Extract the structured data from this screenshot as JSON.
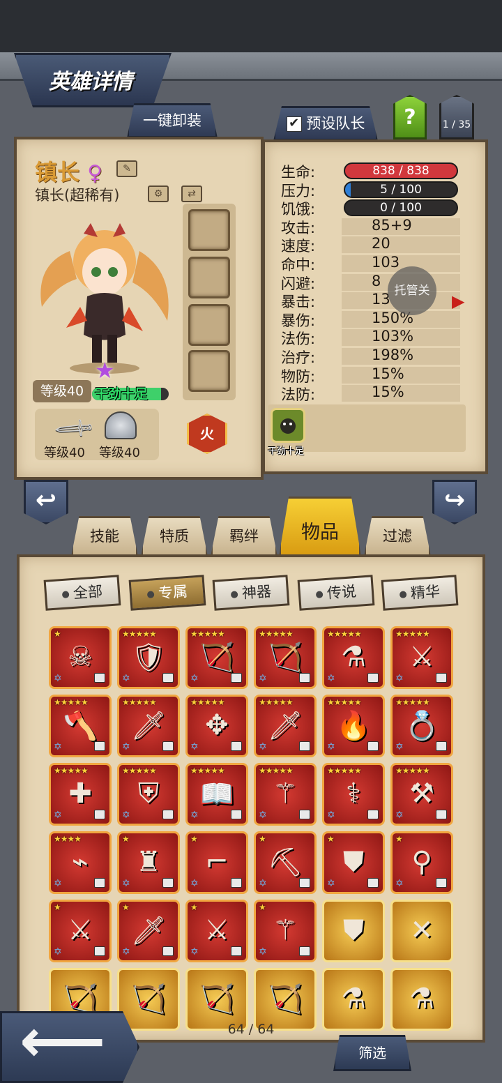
{
  "header": {
    "title": "英雄详情"
  },
  "top_buttons": {
    "unequip_all": "一键卸装",
    "preset_leader": "预设队长",
    "help": "?",
    "page_indicator": "1 / 35"
  },
  "hero": {
    "name": "镇长",
    "gender_symbol": "♀",
    "rarity_line": "镇长(超稀有)",
    "level": "等级40",
    "mood": "干劲十足",
    "mood_fill": 0.9,
    "element": "火",
    "equip": [
      {
        "label": "等级40",
        "icon": "sword-icon"
      },
      {
        "label": "等级40",
        "icon": "helmet-icon"
      }
    ]
  },
  "stats": [
    {
      "label": "生命:",
      "value": "838 / 838",
      "bar": "hp",
      "fill": 1.0,
      "color": "#d1383d"
    },
    {
      "label": "压力:",
      "value": "5 / 100",
      "bar": "stress",
      "fill": 0.05,
      "color": "#2f7fd6"
    },
    {
      "label": "饥饿:",
      "value": "0 / 100",
      "bar": "hunger",
      "fill": 0.0,
      "color": "#777777"
    },
    {
      "label": "攻击:",
      "value": "85+9"
    },
    {
      "label": "速度:",
      "value": "20"
    },
    {
      "label": "命中:",
      "value": "103"
    },
    {
      "label": "闪避:",
      "value": "8"
    },
    {
      "label": "暴击:",
      "value": "13"
    },
    {
      "label": "暴伤:",
      "value": "150%"
    },
    {
      "label": "法伤:",
      "value": "103%"
    },
    {
      "label": "治疗:",
      "value": "198%"
    },
    {
      "label": "物防:",
      "value": "15%"
    },
    {
      "label": "法防:",
      "value": "15%"
    }
  ],
  "skill": {
    "label": "干劲十足"
  },
  "auto_toggle": "托管关",
  "tabs": [
    "技能",
    "特质",
    "羁绊",
    "物品",
    "过滤"
  ],
  "active_tab": "物品",
  "filters": [
    "全部",
    "专属",
    "神器",
    "传说",
    "精华"
  ],
  "active_filter": "专属",
  "items": [
    {
      "stars": "★",
      "glyph": "☠",
      "type": "red"
    },
    {
      "stars": "★★★★★",
      "glyph": "🛡",
      "type": "red"
    },
    {
      "stars": "★★★★★",
      "glyph": "🏹",
      "type": "red"
    },
    {
      "stars": "★★★★★",
      "glyph": "🏹",
      "type": "red"
    },
    {
      "stars": "★★★★★",
      "glyph": "⚗",
      "type": "red"
    },
    {
      "stars": "★★★★★",
      "glyph": "⚔",
      "type": "red"
    },
    {
      "stars": "★★★★★",
      "glyph": "🪓",
      "type": "red"
    },
    {
      "stars": "★★★★★",
      "glyph": "🗡",
      "type": "red"
    },
    {
      "stars": "★★★★★",
      "glyph": "✥",
      "type": "red"
    },
    {
      "stars": "★★★★★",
      "glyph": "🗡",
      "type": "red"
    },
    {
      "stars": "★★★★★",
      "glyph": "🔥",
      "type": "red"
    },
    {
      "stars": "★★★★★",
      "glyph": "💍",
      "type": "red"
    },
    {
      "stars": "★★★★★",
      "glyph": "✚",
      "type": "red"
    },
    {
      "stars": "★★★★★",
      "glyph": "⛨",
      "type": "red"
    },
    {
      "stars": "★★★★★",
      "glyph": "📖",
      "type": "red"
    },
    {
      "stars": "★★★★★",
      "glyph": "⚚",
      "type": "red"
    },
    {
      "stars": "★★★★★",
      "glyph": "⚕",
      "type": "red"
    },
    {
      "stars": "★★★★★",
      "glyph": "⚒",
      "type": "red"
    },
    {
      "stars": "★★★★",
      "glyph": "⌁",
      "type": "red"
    },
    {
      "stars": "★",
      "glyph": "♜",
      "type": "red"
    },
    {
      "stars": "★",
      "glyph": "⌐",
      "type": "red"
    },
    {
      "stars": "★",
      "glyph": "⛏",
      "type": "red"
    },
    {
      "stars": "★",
      "glyph": "⛊",
      "type": "red"
    },
    {
      "stars": "★",
      "glyph": "⚲",
      "type": "red"
    },
    {
      "stars": "★",
      "glyph": "⚔",
      "type": "red"
    },
    {
      "stars": "★",
      "glyph": "🗡",
      "type": "red"
    },
    {
      "stars": "★",
      "glyph": "⚔",
      "type": "red"
    },
    {
      "stars": "★",
      "glyph": "⚚",
      "type": "red"
    },
    {
      "stars": "",
      "glyph": "⛊",
      "type": "gold"
    },
    {
      "stars": "",
      "glyph": "✕",
      "type": "gold"
    },
    {
      "stars": "",
      "glyph": "🏹",
      "type": "gold"
    },
    {
      "stars": "",
      "glyph": "🏹",
      "type": "gold"
    },
    {
      "stars": "",
      "glyph": "🏹",
      "type": "gold"
    },
    {
      "stars": "",
      "glyph": "🏹",
      "type": "gold"
    },
    {
      "stars": "",
      "glyph": "⚗",
      "type": "gold"
    },
    {
      "stars": "",
      "glyph": "⚗",
      "type": "gold"
    }
  ],
  "item_counter": "64 / 64",
  "bottom": {
    "filter_button": "筛选"
  }
}
